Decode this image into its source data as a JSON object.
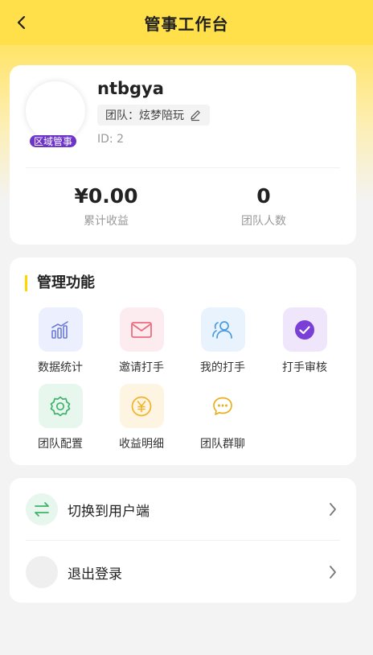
{
  "header": {
    "title": "管事工作台"
  },
  "profile": {
    "username": "ntbgya",
    "team_label": "团队：炫梦陪玩",
    "id_text": "ID: 2",
    "role_badge": "区域管事"
  },
  "stats": [
    {
      "value": "¥0.00",
      "label": "累计收益"
    },
    {
      "value": "0",
      "label": "团队人数"
    }
  ],
  "functions": {
    "title": "管理功能",
    "items": [
      {
        "label": "数据统计",
        "icon": "bar-chart-icon",
        "bg": "#eceffd",
        "color": "#6b7bd8"
      },
      {
        "label": "邀请打手",
        "icon": "mail-icon",
        "bg": "#fdecef",
        "color": "#ee6b7c"
      },
      {
        "label": "我的打手",
        "icon": "users-icon",
        "bg": "#e9f3fd",
        "color": "#4a9be0"
      },
      {
        "label": "打手审核",
        "icon": "check-circle-icon",
        "bg": "#efe6fb",
        "color": "#7a3fd6"
      },
      {
        "label": "团队配置",
        "icon": "settings-icon",
        "bg": "#e8f7ee",
        "color": "#3fb36b"
      },
      {
        "label": "收益明细",
        "icon": "yen-coin-icon",
        "bg": "#fdf4e2",
        "color": "#f0b429"
      },
      {
        "label": "团队群聊",
        "icon": "chat-bubble-icon",
        "bg": "#ffffff",
        "color": "#e8b020"
      }
    ]
  },
  "menu": [
    {
      "label": "切换到用户端",
      "icon": "switch-arrows-icon"
    },
    {
      "label": "退出登录",
      "icon": "logout-icon"
    }
  ],
  "colors": {
    "accent": "#ffe04a",
    "badge": "#6c34c9"
  }
}
